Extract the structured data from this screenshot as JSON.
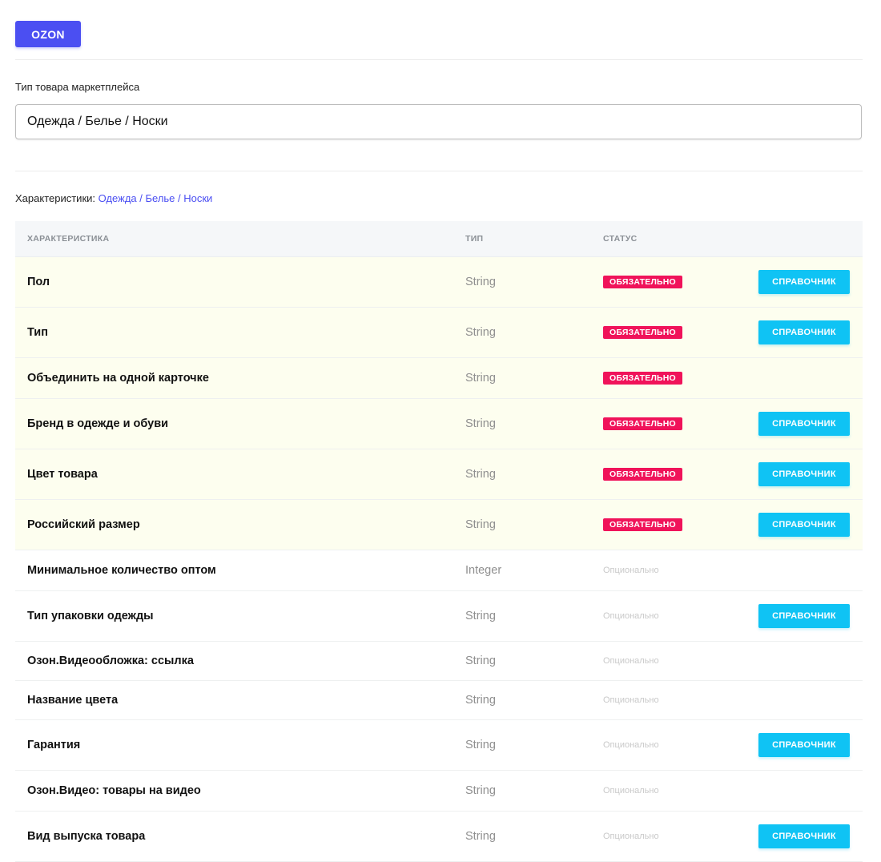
{
  "marketplace_button": "OZON",
  "type_field": {
    "label": "Тип товара маркетплейса",
    "value": "Одежда / Белье / Носки"
  },
  "characteristics": {
    "label": "Характеристики:",
    "link": "Одежда / Белье / Носки"
  },
  "table": {
    "headers": {
      "name": "ХАРАКТЕРИСТИКА",
      "type": "ТИП",
      "status": "СТАТУС"
    },
    "rows": [
      {
        "name": "Пол",
        "type": "String",
        "status": "ОБЯЗАТЕЛЬНО",
        "required": true,
        "action": "СПРАВОЧНИК"
      },
      {
        "name": "Тип",
        "type": "String",
        "status": "ОБЯЗАТЕЛЬНО",
        "required": true,
        "action": "СПРАВОЧНИК"
      },
      {
        "name": "Объединить на одной карточке",
        "type": "String",
        "status": "ОБЯЗАТЕЛЬНО",
        "required": true,
        "action": ""
      },
      {
        "name": "Бренд в одежде и обуви",
        "type": "String",
        "status": "ОБЯЗАТЕЛЬНО",
        "required": true,
        "action": "СПРАВОЧНИК"
      },
      {
        "name": "Цвет товара",
        "type": "String",
        "status": "ОБЯЗАТЕЛЬНО",
        "required": true,
        "action": "СПРАВОЧНИК"
      },
      {
        "name": "Российский размер",
        "type": "String",
        "status": "ОБЯЗАТЕЛЬНО",
        "required": true,
        "action": "СПРАВОЧНИК"
      },
      {
        "name": "Минимальное количество оптом",
        "type": "Integer",
        "status": "Опционально",
        "required": false,
        "action": ""
      },
      {
        "name": "Тип упаковки одежды",
        "type": "String",
        "status": "Опционально",
        "required": false,
        "action": "СПРАВОЧНИК"
      },
      {
        "name": "Озон.Видеообложка: ссылка",
        "type": "String",
        "status": "Опционально",
        "required": false,
        "action": ""
      },
      {
        "name": "Название цвета",
        "type": "String",
        "status": "Опционально",
        "required": false,
        "action": ""
      },
      {
        "name": "Гарантия",
        "type": "String",
        "status": "Опционально",
        "required": false,
        "action": "СПРАВОЧНИК"
      },
      {
        "name": "Озон.Видео: товары на видео",
        "type": "String",
        "status": "Опционально",
        "required": false,
        "action": ""
      },
      {
        "name": "Вид выпуска товара",
        "type": "String",
        "status": "Опционально",
        "required": false,
        "action": "СПРАВОЧНИК"
      }
    ]
  },
  "colors": {
    "brand": "#4b4ff2",
    "required_badge": "#f0135a",
    "reference_button": "#0fc3f4",
    "required_row_bg": "#fdfeef"
  }
}
